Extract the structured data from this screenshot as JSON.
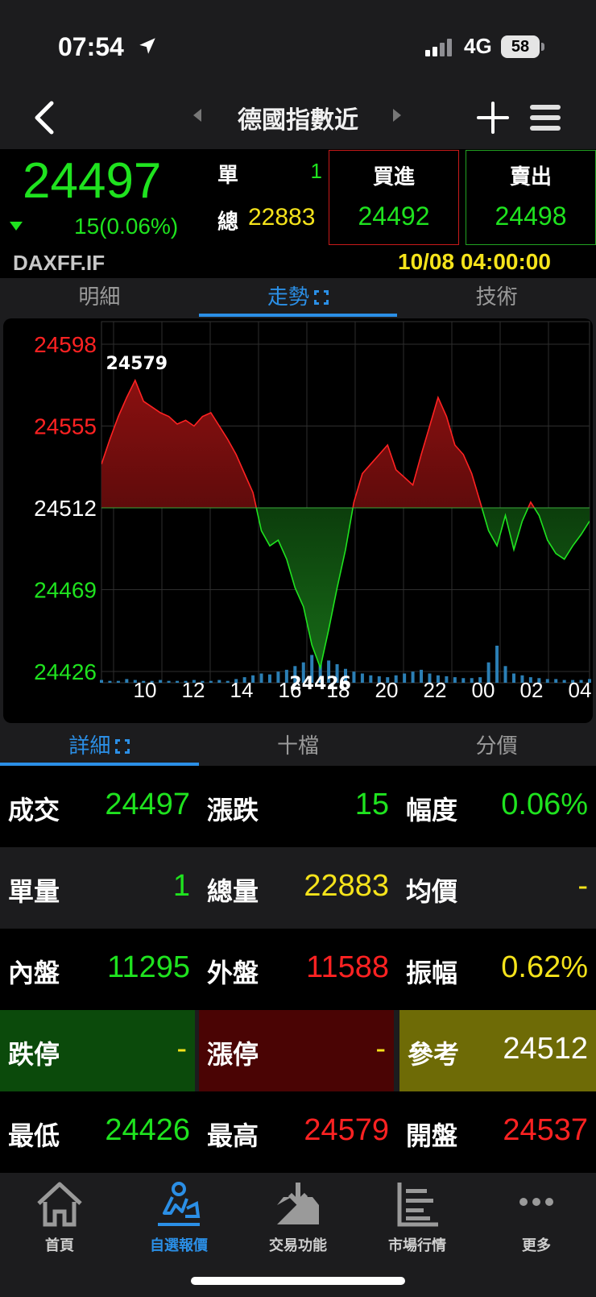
{
  "status_bar": {
    "time": "07:54",
    "network": "4G",
    "battery": "58"
  },
  "nav": {
    "title": "德國指數近"
  },
  "quote": {
    "price": "24497",
    "change": "15(0.06%)",
    "single_label": "單",
    "single_value": "1",
    "total_label": "總",
    "total_value": "22883",
    "buy_label": "買進",
    "buy_value": "24492",
    "sell_label": "賣出",
    "sell_value": "24498",
    "symbol": "DAXFF.IF",
    "datetime": "10/08 04:00:00"
  },
  "top_tabs": [
    {
      "label": "明細"
    },
    {
      "label": "走勢"
    },
    {
      "label": "技術"
    }
  ],
  "chart_data": {
    "type": "line",
    "y_tick_labels": [
      "24598",
      "24555",
      "24512",
      "24469",
      "24426"
    ],
    "ylim": [
      24426,
      24598
    ],
    "reference": 24512,
    "x_tick_labels": [
      "10",
      "12",
      "14",
      "16",
      "18",
      "20",
      "22",
      "00",
      "02",
      "04"
    ],
    "annotations": {
      "high": "24579",
      "low": "24426"
    },
    "series": [
      {
        "values": [
          24535,
          24548,
          24560,
          24570,
          24579,
          24568,
          24565,
          24562,
          24560,
          24556,
          24558,
          24555,
          24560,
          24562,
          24555,
          24548,
          24540,
          24530,
          24520,
          24500,
          24492,
          24495,
          24485,
          24470,
          24460,
          24440,
          24428,
          24448,
          24470,
          24490,
          24515,
          24530,
          24535,
          24540,
          24545,
          24532,
          24528,
          24524,
          24540,
          24555,
          24570,
          24560,
          24545,
          24540,
          24530,
          24515,
          24500,
          24492,
          24508,
          24490,
          24505,
          24515,
          24508,
          24495,
          24488,
          24485,
          24492,
          24498,
          24505
        ]
      }
    ],
    "volume": [
      3,
      2,
      2,
      4,
      3,
      2,
      2,
      3,
      2,
      2,
      2,
      3,
      2,
      2,
      3,
      2,
      4,
      6,
      8,
      10,
      9,
      12,
      14,
      18,
      22,
      30,
      35,
      24,
      20,
      15,
      12,
      10,
      8,
      7,
      6,
      8,
      10,
      12,
      14,
      10,
      8,
      7,
      6,
      5,
      5,
      6,
      22,
      40,
      18,
      10,
      8,
      6,
      5,
      4,
      4,
      3,
      3,
      3,
      4
    ]
  },
  "detail_tabs": [
    {
      "label": "詳細"
    },
    {
      "label": "十檔"
    },
    {
      "label": "分價"
    }
  ],
  "details": [
    [
      {
        "key": "成交",
        "value": "24497"
      },
      {
        "key": "漲跌",
        "value": "15"
      },
      {
        "key": "幅度",
        "value": "0.06%"
      }
    ],
    [
      {
        "key": "單量",
        "value": "1"
      },
      {
        "key": "總量",
        "value": "22883"
      },
      {
        "key": "均價",
        "value": "-"
      }
    ],
    [
      {
        "key": "內盤",
        "value": "11295"
      },
      {
        "key": "外盤",
        "value": "11588"
      },
      {
        "key": "振幅",
        "value": "0.62%"
      }
    ],
    [
      {
        "key": "跌停",
        "value": "-"
      },
      {
        "key": "漲停",
        "value": "-"
      },
      {
        "key": "參考",
        "value": "24512"
      }
    ],
    [
      {
        "key": "最低",
        "value": "24426"
      },
      {
        "key": "最高",
        "value": "24579"
      },
      {
        "key": "開盤",
        "value": "24537"
      }
    ]
  ],
  "tab_bar": [
    {
      "label": "首頁",
      "icon": "home-icon"
    },
    {
      "label": "自選報價",
      "icon": "watchlist-icon"
    },
    {
      "label": "交易功能",
      "icon": "trade-icon"
    },
    {
      "label": "市場行情",
      "icon": "market-icon"
    },
    {
      "label": "更多",
      "icon": "more-icon"
    }
  ],
  "colors": {
    "up": "#ff2222",
    "down": "#1fe31f",
    "accent": "#2b8fe6",
    "yellow": "#f5e31b"
  }
}
